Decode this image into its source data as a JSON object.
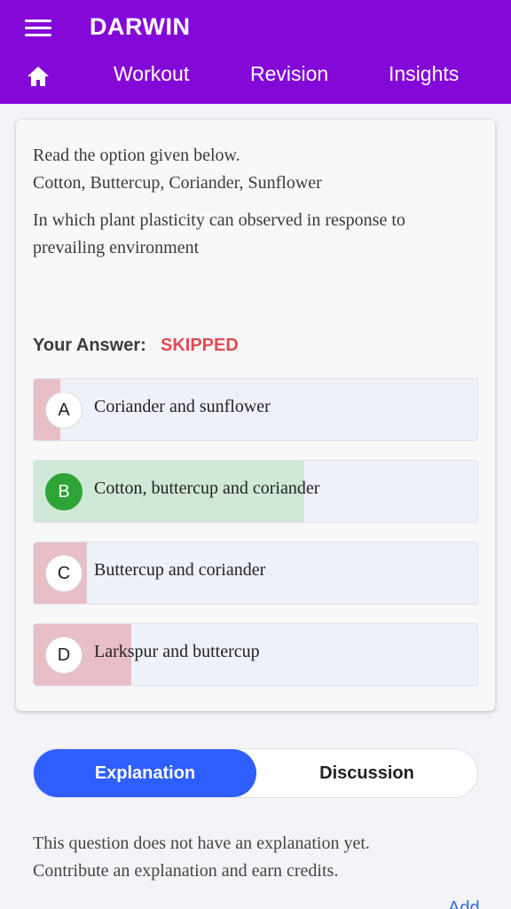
{
  "header": {
    "title": "DARWIN",
    "nav": {
      "workout": "Workout",
      "revision": "Revision",
      "insights": "Insights"
    },
    "color": "#8409d9"
  },
  "question": {
    "line1": "Read the option given below.",
    "line2": "Cotton, Buttercup, Coriander, Sunflower",
    "line3": "In which plant plasticity can observed in response to prevailing environment"
  },
  "answer": {
    "label": "Your Answer:",
    "status": "SKIPPED",
    "status_color": "#e04b55"
  },
  "options": [
    {
      "letter": "A",
      "text": "Coriander and sunflower",
      "response_fraction": 0.06,
      "correct": false
    },
    {
      "letter": "B",
      "text": "Cotton, buttercup and coriander",
      "response_fraction": 0.61,
      "correct": true
    },
    {
      "letter": "C",
      "text": "Buttercup and coriander",
      "response_fraction": 0.12,
      "correct": false
    },
    {
      "letter": "D",
      "text": "Larkspur and buttercup",
      "response_fraction": 0.22,
      "correct": false
    }
  ],
  "tabs": {
    "explanation": "Explanation",
    "discussion": "Discussion",
    "active_color": "#2f5eff"
  },
  "explanation": {
    "line1": "This question does not have an explanation yet.",
    "line2": "Contribute an explanation and earn credits.",
    "add_link": "Add"
  }
}
